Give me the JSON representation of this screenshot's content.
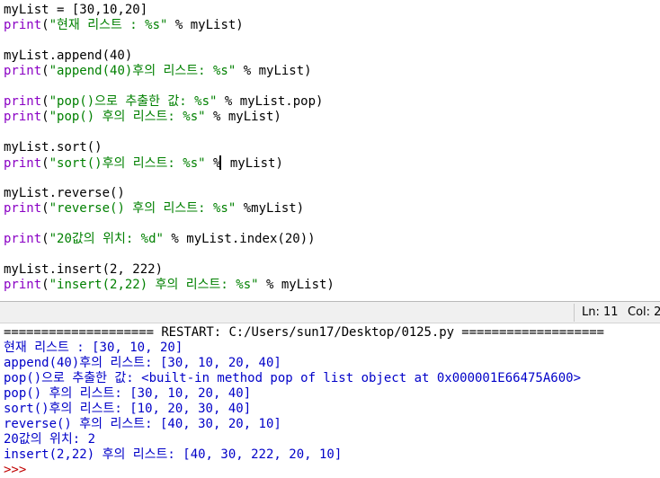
{
  "editor": {
    "lines": [
      {
        "code": "myList = [30,10,20]"
      },
      {
        "fn": "print",
        "open": "(",
        "str": "\"현재 리스트 : %s\"",
        "rest": " % myList)"
      },
      {
        "code": ""
      },
      {
        "code": "myList.append(40)"
      },
      {
        "fn": "print",
        "open": "(",
        "str": "\"append(40)후의 리스트: %s\"",
        "rest": " % myList)"
      },
      {
        "code": ""
      },
      {
        "fn": "print",
        "open": "(",
        "str": "\"pop()으로 추출한 값: %s\"",
        "rest": " % myList.pop)"
      },
      {
        "fn": "print",
        "open": "(",
        "str": "\"pop() 후의 리스트: %s\"",
        "rest": " % myList)"
      },
      {
        "code": ""
      },
      {
        "code": "myList.sort()"
      },
      {
        "fn": "print",
        "open": "(",
        "str": "\"sort()후의 리스트: %s\"",
        "rest_a": " %",
        "rest_b": " myList)",
        "cursor": true
      },
      {
        "code": ""
      },
      {
        "code": "myList.reverse()"
      },
      {
        "fn": "print",
        "open": "(",
        "str": "\"reverse() 후의 리스트: %s\"",
        "rest": " %myList)"
      },
      {
        "code": ""
      },
      {
        "fn": "print",
        "open": "(",
        "str": "\"20값의 위치: %d\"",
        "rest": " % myList.index(20))"
      },
      {
        "code": ""
      },
      {
        "code": "myList.insert(2, 222)"
      },
      {
        "fn": "print",
        "open": "(",
        "str": "\"insert(2,22) 후의 리스트: %s\"",
        "rest": " % myList)"
      }
    ]
  },
  "statusbar": {
    "line_label": "Ln: 11",
    "col_label": "Col: 2"
  },
  "shell": {
    "restart_line": "==================== RESTART: C:/Users/sun17/Desktop/0125.py ===================",
    "output": [
      "현재 리스트 : [30, 10, 20]",
      "append(40)후의 리스트: [30, 10, 20, 40]",
      "pop()으로 추출한 값: <built-in method pop of list object at 0x000001E66475A600>",
      "pop() 후의 리스트: [30, 10, 20, 40]",
      "sort()후의 리스트: [10, 20, 30, 40]",
      "reverse() 후의 리스트: [40, 30, 20, 10]",
      "20값의 위치: 2",
      "insert(2,22) 후의 리스트: [40, 30, 222, 20, 10]"
    ],
    "prompt": ">>>"
  },
  "colors": {
    "builtin": "#8a00c4",
    "string": "#008000",
    "output": "#0000c8",
    "prompt": "#c00000"
  }
}
